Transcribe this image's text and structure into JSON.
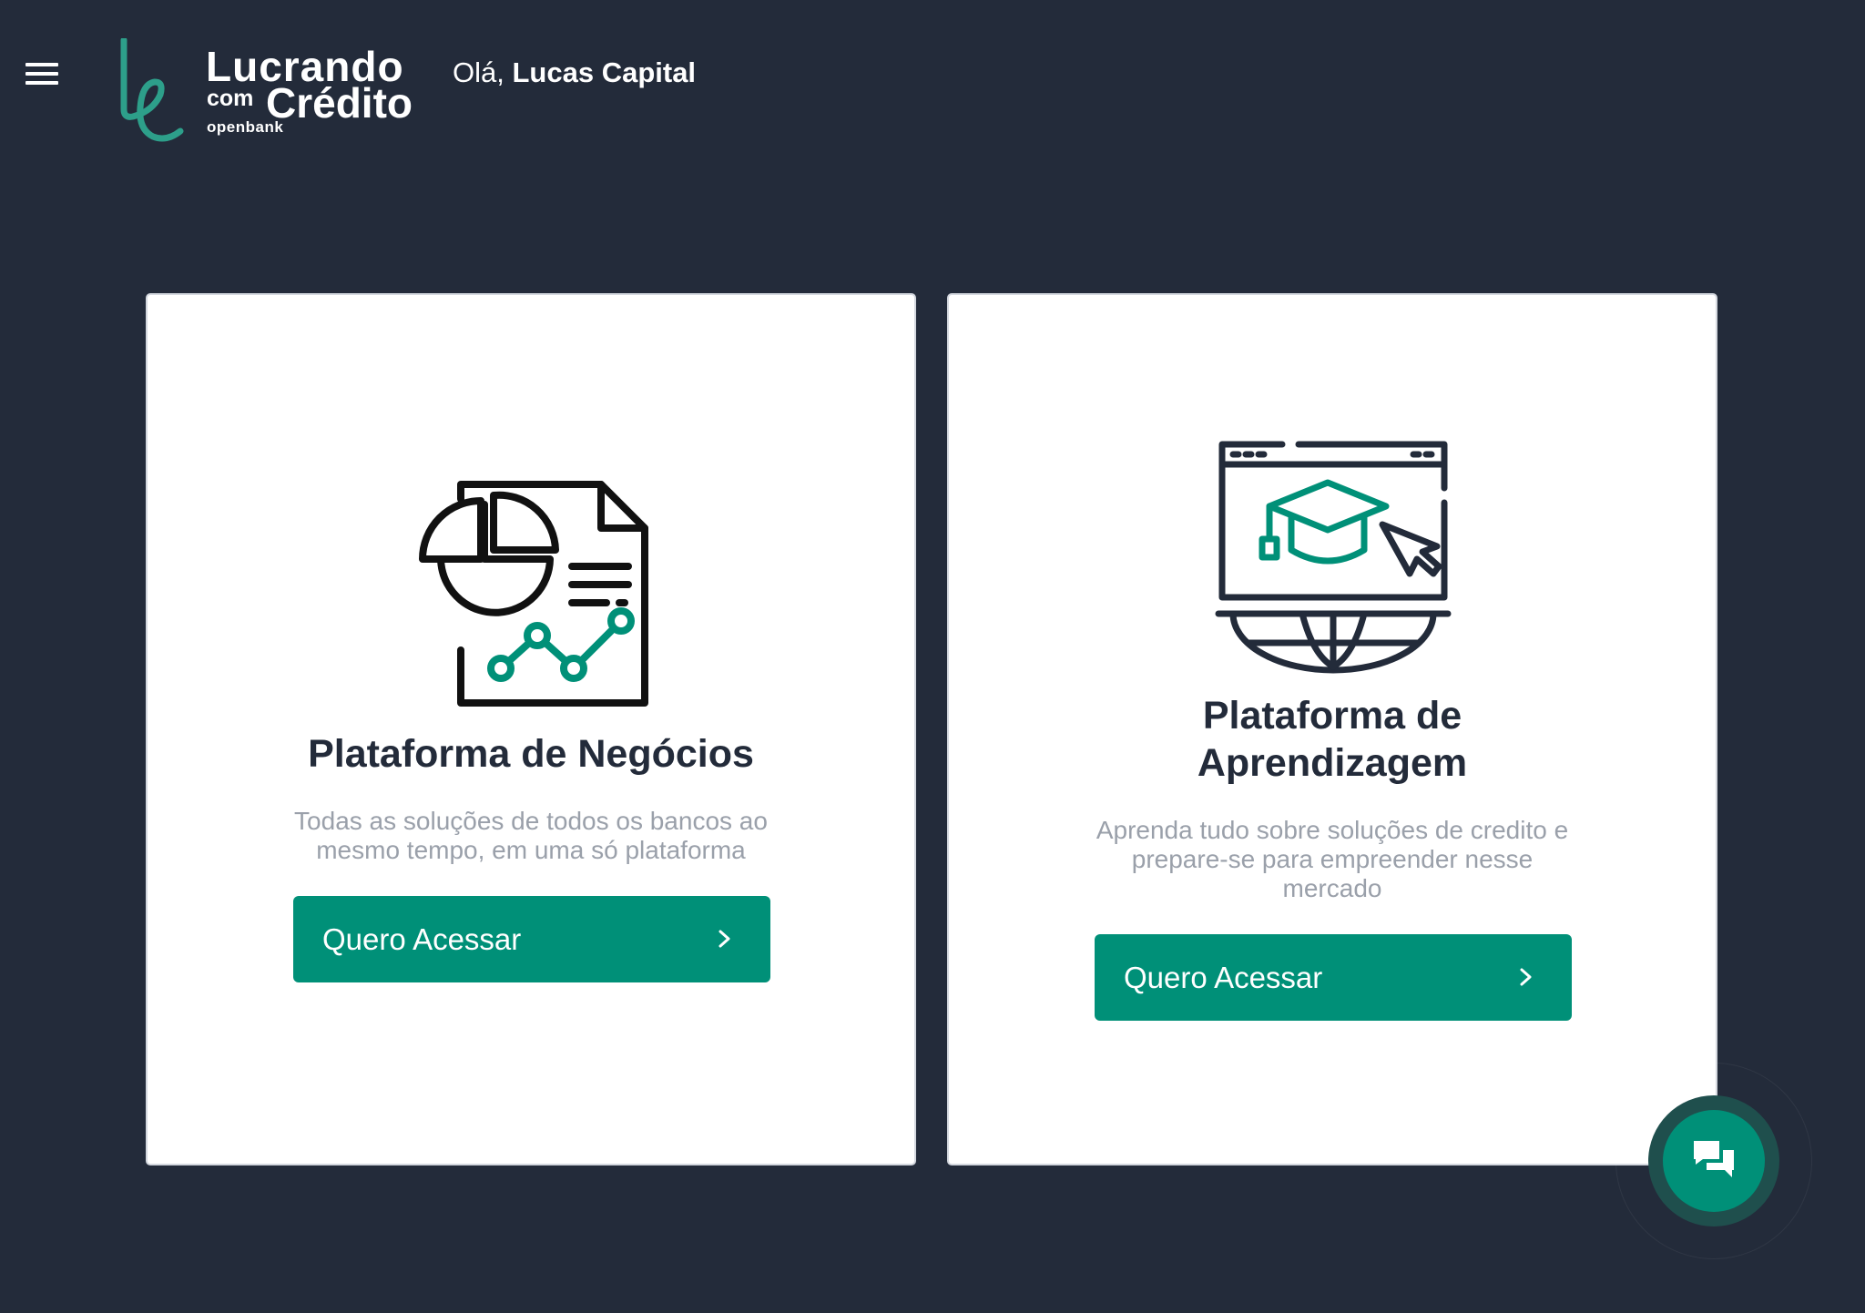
{
  "header": {
    "menu_icon": "hamburger-menu-icon",
    "logo": {
      "line1": "Lucrando",
      "line2_small": "com",
      "line2_large": "Crédito",
      "subtitle": "openbank"
    },
    "greeting": {
      "prefix": "Olá,",
      "name": "Lucas Capital"
    }
  },
  "cards": [
    {
      "icon": "business-report-icon",
      "title": "Plataforma de Negócios",
      "description": "Todas as soluções de todos os bancos ao mesmo tempo, em uma só plataforma",
      "button_label": "Quero Acessar",
      "button_icon": "chevron-right-icon"
    },
    {
      "icon": "online-learning-icon",
      "title_line1": "Plataforma de",
      "title_line2": "Aprendizagem",
      "description": "Aprenda tudo sobre soluções de credito e prepare-se para empreender nesse mercado",
      "button_label": "Quero Acessar",
      "button_icon": "chevron-right-icon"
    }
  ],
  "chat": {
    "icon": "chat-bubbles-icon"
  },
  "colors": {
    "background": "#232b3a",
    "card": "#ffffff",
    "accent": "#009078",
    "text_dark": "#232b3a",
    "text_muted": "#9aa0aa"
  }
}
